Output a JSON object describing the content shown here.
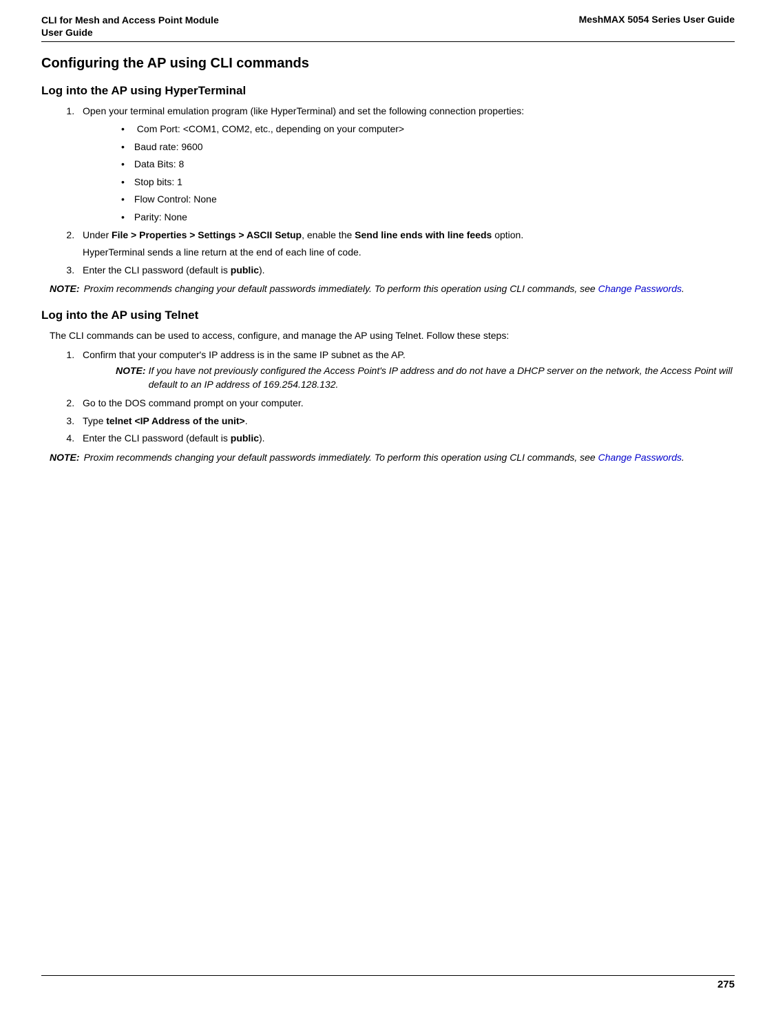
{
  "header": {
    "left_line1": "CLI for Mesh and Access Point Module",
    "left_line2": " User Guide",
    "right": "MeshMAX 5054 Series User Guide"
  },
  "h2": "Configuring the AP using CLI commands",
  "section1": {
    "title": "Log into the AP using HyperTerminal",
    "step1": "Open your terminal emulation program (like HyperTerminal) and set the following connection properties:",
    "bullets": [
      " Com Port: <COM1, COM2, etc., depending on your computer>",
      "Baud rate: 9600",
      "Data Bits: 8",
      "Stop bits: 1",
      "Flow Control: None",
      "Parity: None"
    ],
    "step2_pre": "Under ",
    "step2_bold1": "File > Properties > Settings > ASCII Setup",
    "step2_mid": ", enable the ",
    "step2_bold2": "Send line ends with line feeds",
    "step2_post": " option.",
    "step2_sub": "HyperTerminal sends a line return at the end of each line of code.",
    "step3_pre": "Enter the CLI password (default is ",
    "step3_bold": "public",
    "step3_post": ").",
    "note_label": "NOTE:",
    "note_text_pre": "Proxim recommends changing your default passwords immediately. To perform this operation using CLI commands, see ",
    "note_link": "Change Passwords",
    "note_text_post": "."
  },
  "section2": {
    "title": "Log into the AP using Telnet",
    "intro": "The CLI commands can be used to access, configure, and manage the AP using Telnet. Follow these steps:",
    "step1": "Confirm that your computer's IP address is in the same IP subnet as the AP.",
    "inner_note_label": "NOTE:",
    "inner_note_text": "If you have not previously configured the Access Point's IP address and do not have a DHCP server on the network, the Access Point will default to an IP address of 169.254.128.132.",
    "step2": "Go to the DOS command prompt on your computer.",
    "step3_pre": "Type ",
    "step3_bold": "telnet <IP Address of the unit>",
    "step3_post": ".",
    "step4_pre": "Enter the CLI password (default is ",
    "step4_bold": "public",
    "step4_post": ").",
    "note_label": "NOTE:",
    "note_text_pre": "Proxim recommends changing your default passwords immediately. To perform this operation using CLI commands, see ",
    "note_link": "Change Passwords",
    "note_text_post": "."
  },
  "footer": {
    "page": "275"
  }
}
